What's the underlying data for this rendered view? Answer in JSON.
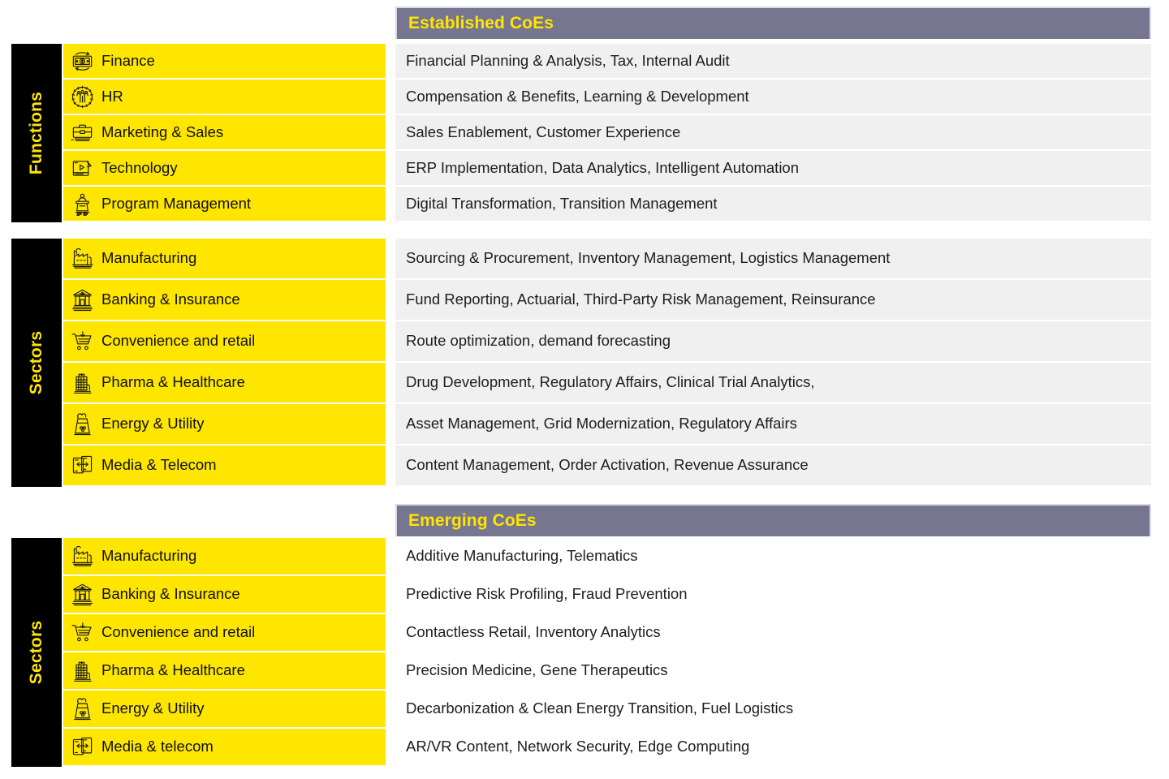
{
  "theme": {
    "accent_yellow": "#ffe600",
    "banner_gray": "#767690",
    "row_gray": "#f0f0f0",
    "rail_black": "#000000",
    "text_dark": "#1d1d1d"
  },
  "sections": [
    {
      "banner": "Established CoEs",
      "groups": [
        {
          "rail_label": "Functions",
          "rows": [
            {
              "icon": "banknote-refresh-icon",
              "category": "Finance",
              "description": "Financial Planning & Analysis, Tax, Internal Audit"
            },
            {
              "icon": "people-gear-icon",
              "category": "HR",
              "description": "Compensation & Benefits, Learning & Development"
            },
            {
              "icon": "briefcase-icon",
              "category": "Marketing & Sales",
              "description": "Sales Enablement, Customer Experience"
            },
            {
              "icon": "media-player-icon",
              "category": "Technology",
              "description": "ERP Implementation, Data Analytics, Intelligent Automation"
            },
            {
              "icon": "podium-speaker-icon",
              "category": "Program Management",
              "description": " Digital Transformation, Transition Management"
            }
          ]
        },
        {
          "rail_label": "Sectors",
          "rows": [
            {
              "icon": "factory-icon",
              "category": "Manufacturing",
              "description": "Sourcing & Procurement, Inventory Management, Logistics Management"
            },
            {
              "icon": "bank-icon",
              "category": "Banking & Insurance",
              "description": "Fund Reporting, Actuarial, Third-Party Risk Management, Reinsurance"
            },
            {
              "icon": "shopping-cart-icon",
              "category": "Convenience and retail",
              "description": "Route optimization, demand forecasting"
            },
            {
              "icon": "hospital-icon",
              "category": "Pharma & Healthcare",
              "description": "Drug Development, Regulatory Affairs, Clinical Trial Analytics,"
            },
            {
              "icon": "power-plant-icon",
              "category": "Energy & Utility",
              "description": " Asset Management, Grid Modernization, Regulatory Affairs"
            },
            {
              "icon": "devices-sync-icon",
              "category": "Media & Telecom",
              "description": "Content Management, Order Activation, Revenue Assurance"
            }
          ]
        }
      ]
    },
    {
      "banner": "Emerging CoEs",
      "groups": [
        {
          "rail_label": "Sectors",
          "rows": [
            {
              "icon": "factory-icon",
              "category": "Manufacturing",
              "description": "Additive Manufacturing, Telematics"
            },
            {
              "icon": "bank-icon",
              "category": "Banking & Insurance",
              "description": "Predictive Risk Profiling, Fraud Prevention"
            },
            {
              "icon": "shopping-cart-icon",
              "category": "Convenience and retail",
              "description": "Contactless Retail, Inventory Analytics"
            },
            {
              "icon": "hospital-icon",
              "category": "Pharma & Healthcare",
              "description": "Precision Medicine, Gene Therapeutics"
            },
            {
              "icon": "power-plant-icon",
              "category": "Energy & Utility",
              "description": "Decarbonization & Clean Energy Transition, Fuel Logistics"
            },
            {
              "icon": "devices-sync-icon",
              "category": "Media & telecom",
              "description": "AR/VR Content, Network Security, Edge Computing"
            }
          ]
        }
      ]
    }
  ]
}
